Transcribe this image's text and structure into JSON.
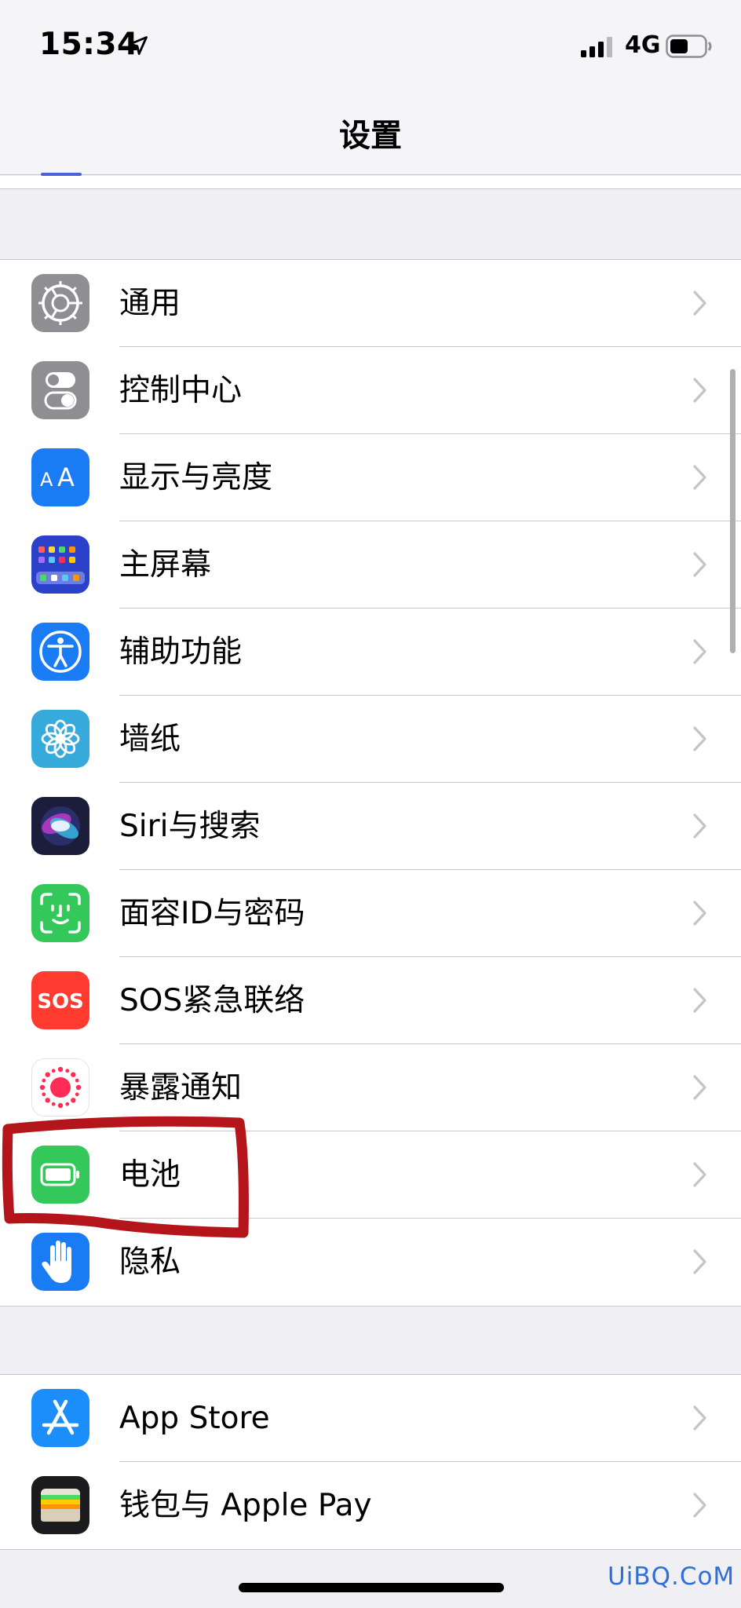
{
  "status_bar": {
    "time": "15:34",
    "network": "4G"
  },
  "nav": {
    "title": "设置"
  },
  "group1": {
    "items": [
      {
        "label": "通用",
        "icon": "gear-icon"
      },
      {
        "label": "控制中心",
        "icon": "toggles-icon"
      },
      {
        "label": "显示与亮度",
        "icon": "text-size-icon"
      },
      {
        "label": "主屏幕",
        "icon": "home-screen-grid-icon"
      },
      {
        "label": "辅助功能",
        "icon": "accessibility-icon"
      },
      {
        "label": "墙纸",
        "icon": "flower-icon"
      },
      {
        "label": "Siri与搜索",
        "icon": "siri-icon"
      },
      {
        "label": "面容ID与密码",
        "icon": "face-id-icon"
      },
      {
        "label": "SOS紧急联络",
        "icon": "sos-icon",
        "icon_text": "SOS"
      },
      {
        "label": "暴露通知",
        "icon": "exposure-notification-icon"
      },
      {
        "label": "电池",
        "icon": "battery-icon"
      },
      {
        "label": "隐私",
        "icon": "hand-icon"
      }
    ]
  },
  "group2": {
    "items": [
      {
        "label": "App Store",
        "icon": "app-store-icon"
      },
      {
        "label": "钱包与 Apple Pay",
        "icon": "wallet-icon"
      }
    ]
  },
  "watermark": "UiBQ.CoM",
  "colors": {
    "background": "#efeff4",
    "separator": "#c8c7cc",
    "annotation": "#b3151b",
    "chevron": "#c4c4c7"
  }
}
